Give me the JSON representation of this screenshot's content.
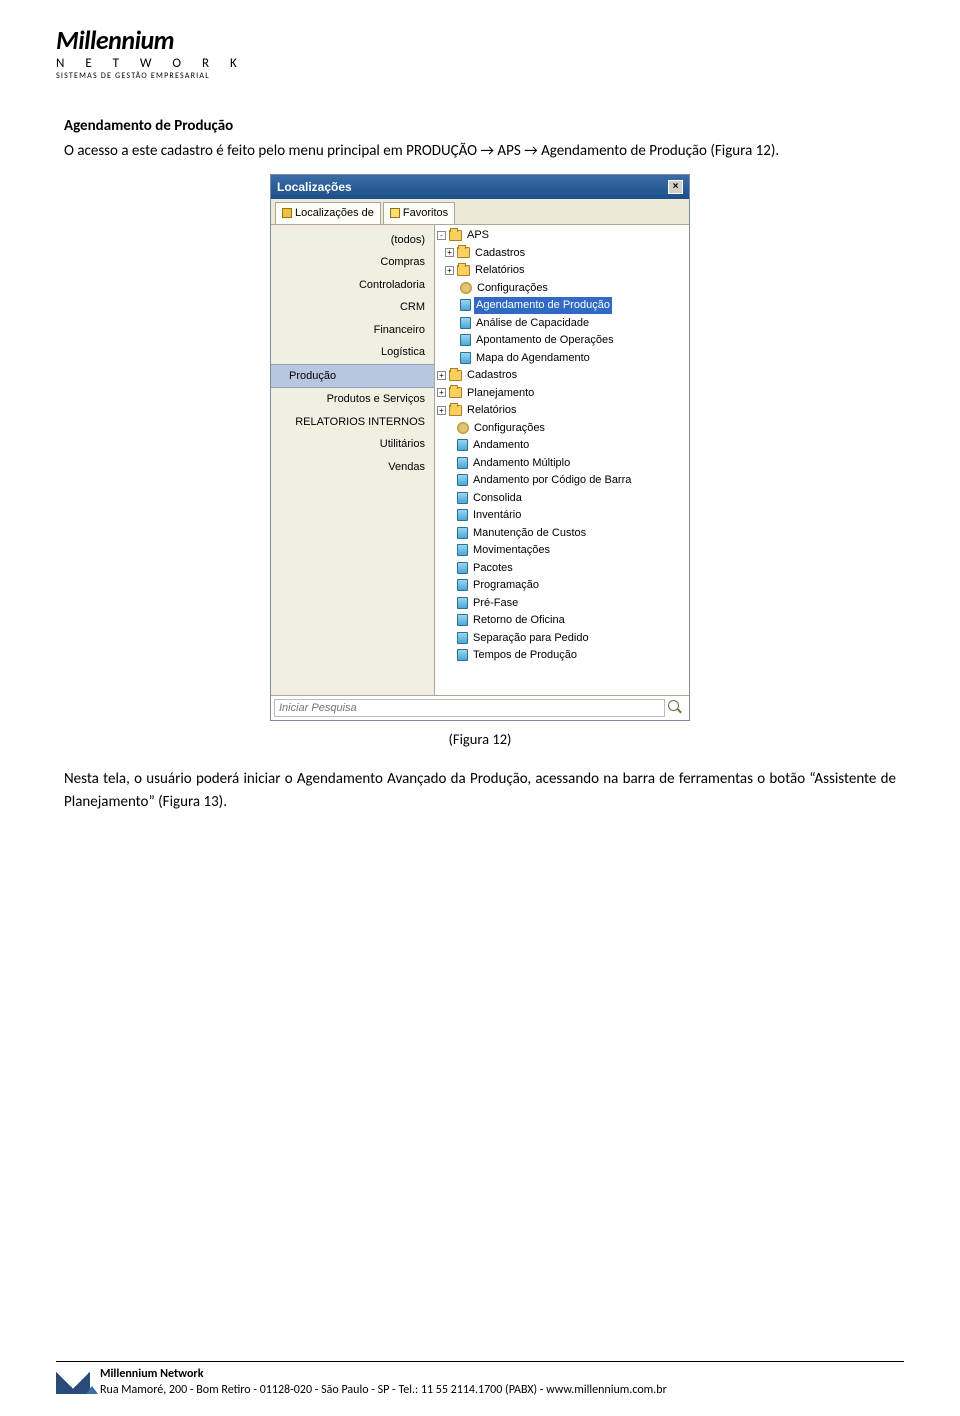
{
  "header": {
    "brand": "Millennium",
    "network": "N E T W O R K",
    "tagline": "SISTEMAS DE GESTÃO EMPRESARIAL"
  },
  "body": {
    "section_title": "Agendamento de Produção",
    "intro": "O acesso a este cadastro é feito pelo menu principal em PRODUÇÃO → APS → Agendamento de Produção (Figura 12).",
    "caption": "(Figura 12)",
    "outro": "Nesta tela, o usuário poderá iniciar o Agendamento Avançado da Produção, acessando na barra de ferramentas o botão “Assistente de Planejamento” (Figura 13)."
  },
  "window": {
    "title": "Localizações",
    "tabs": {
      "a": "Localizações de",
      "b": "Favoritos"
    },
    "left": [
      "(todos)",
      "Compras",
      "Controladoria",
      "CRM",
      "Financeiro",
      "Logística",
      "Produção",
      "Produtos e Serviços",
      "RELATORIOS INTERNOS",
      "Utilitários",
      "Vendas"
    ],
    "left_selected_index": 6,
    "tree": {
      "aps": "APS",
      "aps_children": {
        "cadastros": "Cadastros",
        "relatorios": "Relatórios",
        "config": "Configurações",
        "agendamento": "Agendamento de Produção",
        "analise": "Análise de Capacidade",
        "apontamento": "Apontamento de Operações",
        "mapa": "Mapa do Agendamento"
      },
      "root_cadastros": "Cadastros",
      "root_planejamento": "Planejamento",
      "root_relatorios": "Relatórios",
      "root_config": "Configurações",
      "andamento": "Andamento",
      "andamento_mult": "Andamento Múltiplo",
      "andamento_barra": "Andamento por Código de Barra",
      "consolida": "Consolida",
      "inventario": "Inventário",
      "manut_custos": "Manutenção de Custos",
      "moviment": "Movimentações",
      "pacotes": "Pacotes",
      "programacao": "Programação",
      "prefase": "Pré-Fase",
      "retorno": "Retorno de Oficina",
      "separacao": "Separação para Pedido",
      "tempos": "Tempos de Produção"
    },
    "search_placeholder": "Iniciar Pesquisa"
  },
  "footer": {
    "company": "Millennium Network",
    "address": "Rua Mamoré, 200 - Bom Retiro - 01128-020 - São Paulo - SP - Tel.: 11 55 2114.1700 (PABX) - www.millennium.com.br"
  }
}
